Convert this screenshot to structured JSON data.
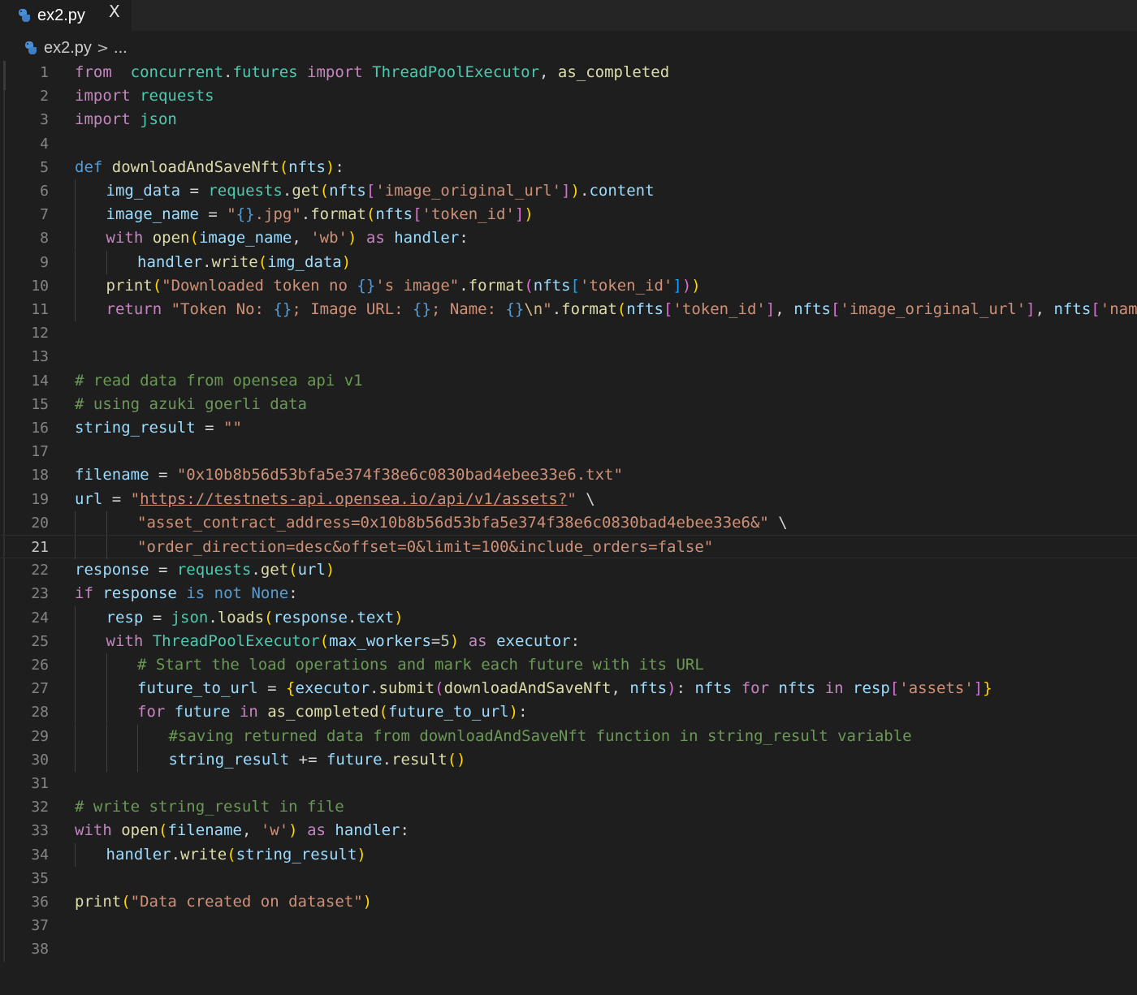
{
  "tab": {
    "label": "ex2.py",
    "close_glyph": "X",
    "icon": "python-file-icon"
  },
  "breadcrumb": {
    "file": "ex2.py",
    "separator": ">",
    "trail": "..."
  },
  "editor": {
    "active_line": 21,
    "language": "python"
  },
  "lines": [
    {
      "n": "1",
      "indent": 0,
      "t": [
        [
          "kw",
          "from"
        ],
        [
          "",
          "  "
        ],
        [
          "mod",
          "concurrent"
        ],
        [
          "",
          "."
        ],
        [
          "mod",
          "futures"
        ],
        [
          "",
          " "
        ],
        [
          "kw",
          "import"
        ],
        [
          "",
          " "
        ],
        [
          "mod",
          "ThreadPoolExecutor"
        ],
        [
          "",
          ", "
        ],
        [
          "fn",
          "as_completed"
        ]
      ]
    },
    {
      "n": "2",
      "indent": 0,
      "t": [
        [
          "kw",
          "import"
        ],
        [
          "",
          " "
        ],
        [
          "mod",
          "requests"
        ]
      ]
    },
    {
      "n": "3",
      "indent": 0,
      "t": [
        [
          "kw",
          "import"
        ],
        [
          "",
          " "
        ],
        [
          "mod",
          "json"
        ]
      ]
    },
    {
      "n": "4",
      "indent": 0,
      "t": []
    },
    {
      "n": "5",
      "indent": 0,
      "t": [
        [
          "def",
          "def"
        ],
        [
          "",
          " "
        ],
        [
          "fn",
          "downloadAndSaveNft"
        ],
        [
          "b1",
          "("
        ],
        [
          "var",
          "nfts"
        ],
        [
          "b1",
          ")"
        ],
        [
          "",
          ":"
        ]
      ]
    },
    {
      "n": "6",
      "indent": 1,
      "t": [
        [
          "var",
          "img_data"
        ],
        [
          "",
          " = "
        ],
        [
          "mod",
          "requests"
        ],
        [
          "",
          "."
        ],
        [
          "fn",
          "get"
        ],
        [
          "b1",
          "("
        ],
        [
          "var",
          "nfts"
        ],
        [
          "b2",
          "["
        ],
        [
          "str",
          "'image_original_url'"
        ],
        [
          "b2",
          "]"
        ],
        [
          "b1",
          ")"
        ],
        [
          "",
          "."
        ],
        [
          "var",
          "content"
        ]
      ]
    },
    {
      "n": "7",
      "indent": 1,
      "t": [
        [
          "var",
          "image_name"
        ],
        [
          "",
          " = "
        ],
        [
          "str",
          "\""
        ],
        [
          "ph",
          "{}"
        ],
        [
          "str",
          ".jpg\""
        ],
        [
          "",
          "."
        ],
        [
          "fn",
          "format"
        ],
        [
          "b1",
          "("
        ],
        [
          "var",
          "nfts"
        ],
        [
          "b2",
          "["
        ],
        [
          "str",
          "'token_id'"
        ],
        [
          "b2",
          "]"
        ],
        [
          "b1",
          ")"
        ]
      ]
    },
    {
      "n": "8",
      "indent": 1,
      "t": [
        [
          "kw",
          "with"
        ],
        [
          "",
          " "
        ],
        [
          "fn",
          "open"
        ],
        [
          "b1",
          "("
        ],
        [
          "var",
          "image_name"
        ],
        [
          "",
          ", "
        ],
        [
          "str",
          "'wb'"
        ],
        [
          "b1",
          ")"
        ],
        [
          "",
          " "
        ],
        [
          "kw",
          "as"
        ],
        [
          "",
          " "
        ],
        [
          "var",
          "handler"
        ],
        [
          "",
          ":"
        ]
      ]
    },
    {
      "n": "9",
      "indent": 2,
      "t": [
        [
          "var",
          "handler"
        ],
        [
          "",
          "."
        ],
        [
          "fn",
          "write"
        ],
        [
          "b1",
          "("
        ],
        [
          "var",
          "img_data"
        ],
        [
          "b1",
          ")"
        ]
      ]
    },
    {
      "n": "10",
      "indent": 1,
      "t": [
        [
          "fn",
          "print"
        ],
        [
          "b1",
          "("
        ],
        [
          "str",
          "\"Downloaded token no "
        ],
        [
          "ph",
          "{}"
        ],
        [
          "str",
          "'s image\""
        ],
        [
          "",
          "."
        ],
        [
          "fn",
          "format"
        ],
        [
          "b2",
          "("
        ],
        [
          "var",
          "nfts"
        ],
        [
          "b3",
          "["
        ],
        [
          "str",
          "'token_id'"
        ],
        [
          "b3",
          "]"
        ],
        [
          "b2",
          ")"
        ],
        [
          "b1",
          ")"
        ]
      ]
    },
    {
      "n": "11",
      "indent": 1,
      "t": [
        [
          "kw",
          "return"
        ],
        [
          "",
          " "
        ],
        [
          "str",
          "\"Token No: "
        ],
        [
          "ph",
          "{}"
        ],
        [
          "str",
          "; Image URL: "
        ],
        [
          "ph",
          "{}"
        ],
        [
          "str",
          "; Name: "
        ],
        [
          "ph",
          "{}"
        ],
        [
          "esc",
          "\\n"
        ],
        [
          "str",
          "\""
        ],
        [
          "",
          "."
        ],
        [
          "fn",
          "format"
        ],
        [
          "b1",
          "("
        ],
        [
          "var",
          "nfts"
        ],
        [
          "b2",
          "["
        ],
        [
          "str",
          "'token_id'"
        ],
        [
          "b2",
          "]"
        ],
        [
          "",
          ", "
        ],
        [
          "var",
          "nfts"
        ],
        [
          "b2",
          "["
        ],
        [
          "str",
          "'image_original_url'"
        ],
        [
          "b2",
          "]"
        ],
        [
          "",
          ", "
        ],
        [
          "var",
          "nfts"
        ],
        [
          "b2",
          "["
        ],
        [
          "str",
          "'name'"
        ],
        [
          "b2",
          "]"
        ],
        [
          "b1",
          ")"
        ]
      ]
    },
    {
      "n": "12",
      "indent": 0,
      "t": []
    },
    {
      "n": "13",
      "indent": 0,
      "t": []
    },
    {
      "n": "14",
      "indent": 0,
      "t": [
        [
          "com",
          "# read data from opensea api v1"
        ]
      ]
    },
    {
      "n": "15",
      "indent": 0,
      "t": [
        [
          "com",
          "# using azuki goerli data"
        ]
      ]
    },
    {
      "n": "16",
      "indent": 0,
      "t": [
        [
          "var",
          "string_result"
        ],
        [
          "",
          " = "
        ],
        [
          "str",
          "\"\""
        ]
      ]
    },
    {
      "n": "17",
      "indent": 0,
      "t": []
    },
    {
      "n": "18",
      "indent": 0,
      "t": [
        [
          "var",
          "filename"
        ],
        [
          "",
          " = "
        ],
        [
          "str",
          "\"0x10b8b56d53bfa5e374f38e6c0830bad4ebee33e6.txt\""
        ]
      ]
    },
    {
      "n": "19",
      "indent": 0,
      "t": [
        [
          "var",
          "url"
        ],
        [
          "",
          " = "
        ],
        [
          "str",
          "\""
        ],
        [
          "link",
          "https://testnets-api.opensea.io/api/v1/assets?"
        ],
        [
          "str",
          "\""
        ],
        [
          "",
          " \\"
        ]
      ]
    },
    {
      "n": "20",
      "indent": 2,
      "t": [
        [
          "str",
          "\"asset_contract_address=0x10b8b56d53bfa5e374f38e6c0830bad4ebee33e6&\""
        ],
        [
          "",
          " \\"
        ]
      ]
    },
    {
      "n": "21",
      "indent": 2,
      "t": [
        [
          "str",
          "\"order_direction=desc&offset=0&limit=100&include_orders=false\""
        ]
      ]
    },
    {
      "n": "22",
      "indent": 0,
      "t": [
        [
          "var",
          "response"
        ],
        [
          "",
          " = "
        ],
        [
          "mod",
          "requests"
        ],
        [
          "",
          "."
        ],
        [
          "fn",
          "get"
        ],
        [
          "b1",
          "("
        ],
        [
          "var",
          "url"
        ],
        [
          "b1",
          ")"
        ]
      ]
    },
    {
      "n": "23",
      "indent": 0,
      "t": [
        [
          "kw",
          "if"
        ],
        [
          "",
          " "
        ],
        [
          "var",
          "response"
        ],
        [
          "",
          " "
        ],
        [
          "def",
          "is"
        ],
        [
          "",
          " "
        ],
        [
          "def",
          "not"
        ],
        [
          "",
          " "
        ],
        [
          "def",
          "None"
        ],
        [
          "",
          ":"
        ]
      ]
    },
    {
      "n": "24",
      "indent": 1,
      "t": [
        [
          "var",
          "resp"
        ],
        [
          "",
          " = "
        ],
        [
          "mod",
          "json"
        ],
        [
          "",
          "."
        ],
        [
          "fn",
          "loads"
        ],
        [
          "b1",
          "("
        ],
        [
          "var",
          "response"
        ],
        [
          "",
          "."
        ],
        [
          "var",
          "text"
        ],
        [
          "b1",
          ")"
        ]
      ]
    },
    {
      "n": "25",
      "indent": 1,
      "t": [
        [
          "kw",
          "with"
        ],
        [
          "",
          " "
        ],
        [
          "mod",
          "ThreadPoolExecutor"
        ],
        [
          "b1",
          "("
        ],
        [
          "var",
          "max_workers"
        ],
        [
          "",
          "="
        ],
        [
          "num",
          "5"
        ],
        [
          "b1",
          ")"
        ],
        [
          "",
          " "
        ],
        [
          "kw",
          "as"
        ],
        [
          "",
          " "
        ],
        [
          "var",
          "executor"
        ],
        [
          "",
          ":"
        ]
      ]
    },
    {
      "n": "26",
      "indent": 2,
      "t": [
        [
          "com",
          "# Start the load operations and mark each future with its URL"
        ]
      ]
    },
    {
      "n": "27",
      "indent": 2,
      "t": [
        [
          "var",
          "future_to_url"
        ],
        [
          "",
          " = "
        ],
        [
          "b1",
          "{"
        ],
        [
          "var",
          "executor"
        ],
        [
          "",
          "."
        ],
        [
          "fn",
          "submit"
        ],
        [
          "b2",
          "("
        ],
        [
          "fn",
          "downloadAndSaveNft"
        ],
        [
          "",
          ", "
        ],
        [
          "var",
          "nfts"
        ],
        [
          "b2",
          ")"
        ],
        [
          "",
          ": "
        ],
        [
          "var",
          "nfts"
        ],
        [
          "",
          " "
        ],
        [
          "kw",
          "for"
        ],
        [
          "",
          " "
        ],
        [
          "var",
          "nfts"
        ],
        [
          "",
          " "
        ],
        [
          "kw",
          "in"
        ],
        [
          "",
          " "
        ],
        [
          "var",
          "resp"
        ],
        [
          "b2",
          "["
        ],
        [
          "str",
          "'assets'"
        ],
        [
          "b2",
          "]"
        ],
        [
          "b1",
          "}"
        ]
      ]
    },
    {
      "n": "28",
      "indent": 2,
      "t": [
        [
          "kw",
          "for"
        ],
        [
          "",
          " "
        ],
        [
          "var",
          "future"
        ],
        [
          "",
          " "
        ],
        [
          "kw",
          "in"
        ],
        [
          "",
          " "
        ],
        [
          "fn",
          "as_completed"
        ],
        [
          "b1",
          "("
        ],
        [
          "var",
          "future_to_url"
        ],
        [
          "b1",
          ")"
        ],
        [
          "",
          ":"
        ]
      ]
    },
    {
      "n": "29",
      "indent": 3,
      "t": [
        [
          "com",
          "#saving returned data from downloadAndSaveNft function in string_result variable"
        ]
      ]
    },
    {
      "n": "30",
      "indent": 3,
      "t": [
        [
          "var",
          "string_result"
        ],
        [
          "",
          " += "
        ],
        [
          "var",
          "future"
        ],
        [
          "",
          "."
        ],
        [
          "fn",
          "result"
        ],
        [
          "b1",
          "()"
        ]
      ]
    },
    {
      "n": "31",
      "indent": 0,
      "t": []
    },
    {
      "n": "32",
      "indent": 0,
      "t": [
        [
          "com",
          "# write string_result in file"
        ]
      ]
    },
    {
      "n": "33",
      "indent": 0,
      "t": [
        [
          "kw",
          "with"
        ],
        [
          "",
          " "
        ],
        [
          "fn",
          "open"
        ],
        [
          "b1",
          "("
        ],
        [
          "var",
          "filename"
        ],
        [
          "",
          ", "
        ],
        [
          "str",
          "'w'"
        ],
        [
          "b1",
          ")"
        ],
        [
          "",
          " "
        ],
        [
          "kw",
          "as"
        ],
        [
          "",
          " "
        ],
        [
          "var",
          "handler"
        ],
        [
          "",
          ":"
        ]
      ]
    },
    {
      "n": "34",
      "indent": 1,
      "t": [
        [
          "var",
          "handler"
        ],
        [
          "",
          "."
        ],
        [
          "fn",
          "write"
        ],
        [
          "b1",
          "("
        ],
        [
          "var",
          "string_result"
        ],
        [
          "b1",
          ")"
        ]
      ]
    },
    {
      "n": "35",
      "indent": 0,
      "t": []
    },
    {
      "n": "36",
      "indent": 0,
      "t": [
        [
          "fn",
          "print"
        ],
        [
          "b1",
          "("
        ],
        [
          "str",
          "\"Data created on dataset\""
        ],
        [
          "b1",
          ")"
        ]
      ]
    },
    {
      "n": "37",
      "indent": 0,
      "t": []
    },
    {
      "n": "38",
      "indent": 0,
      "t": []
    }
  ]
}
